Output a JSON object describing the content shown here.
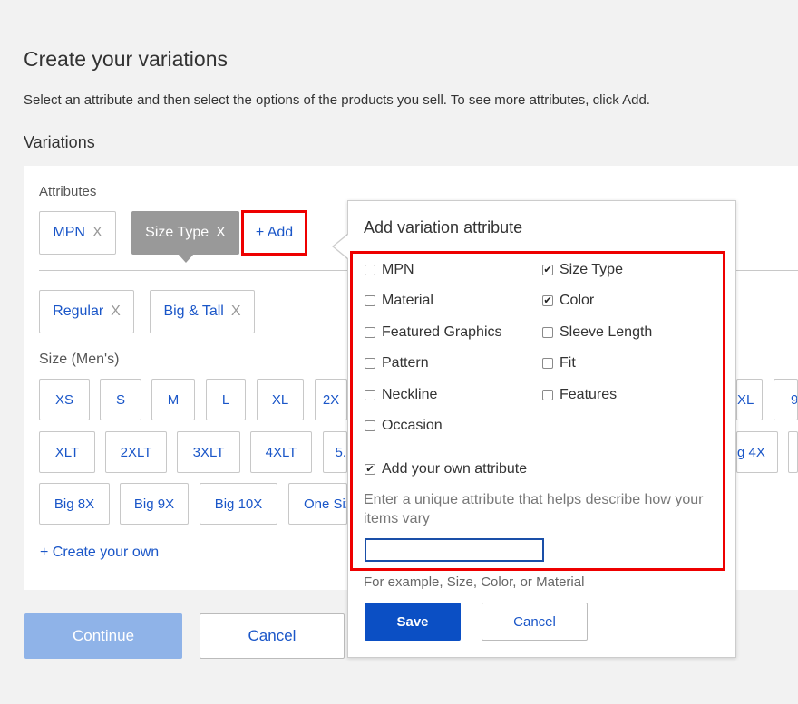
{
  "header": {
    "title": "Create your variations",
    "subtitle": "Select an attribute and then select the options of the products you sell. To see more attributes, click Add.",
    "section_title": "Variations"
  },
  "attributes": {
    "label": "Attributes",
    "chips": [
      {
        "label": "MPN",
        "remove": "X"
      },
      {
        "label": "Size Type",
        "remove": "X"
      }
    ],
    "add_label": "+ Add"
  },
  "size_type_values": [
    {
      "label": "Regular",
      "remove": "X"
    },
    {
      "label": "Big & Tall",
      "remove": "X"
    }
  ],
  "size": {
    "label": "Size (Men's)",
    "row1": [
      "XS",
      "S",
      "M",
      "L",
      "XL",
      "2X",
      "XL",
      "9."
    ],
    "row2": [
      "XLT",
      "2XLT",
      "3XLT",
      "4XLT",
      "5.",
      "g 4X"
    ],
    "row3": [
      "Big 8X",
      "Big 9X",
      "Big 10X",
      "One Siz"
    ]
  },
  "create_own_label": "+ Create your own",
  "footer": {
    "continue_label": "Continue",
    "cancel_label": "Cancel"
  },
  "popover": {
    "title": "Add variation attribute",
    "options_left": [
      {
        "label": "MPN",
        "checked": false
      },
      {
        "label": "Material",
        "checked": false
      },
      {
        "label": "Featured Graphics",
        "checked": false
      },
      {
        "label": "Pattern",
        "checked": false
      },
      {
        "label": "Neckline",
        "checked": false
      },
      {
        "label": "Occasion",
        "checked": false
      }
    ],
    "options_right": [
      {
        "label": "Size Type",
        "checked": true
      },
      {
        "label": "Color",
        "checked": true
      },
      {
        "label": "Sleeve Length",
        "checked": false
      },
      {
        "label": "Fit",
        "checked": false
      },
      {
        "label": "Features",
        "checked": false
      }
    ],
    "own_attribute": {
      "label": "Add your own attribute",
      "checked": true
    },
    "hint": "Enter a unique attribute that helps describe how your items vary",
    "input_value": "",
    "example": "For example, Size, Color, or Material",
    "save_label": "Save",
    "cancel_label": "Cancel"
  },
  "colors": {
    "link": "#1a56c8",
    "highlight": "#ee0000",
    "primary_button": "#0b4fc4",
    "disabled_button": "#8fb3e8"
  }
}
